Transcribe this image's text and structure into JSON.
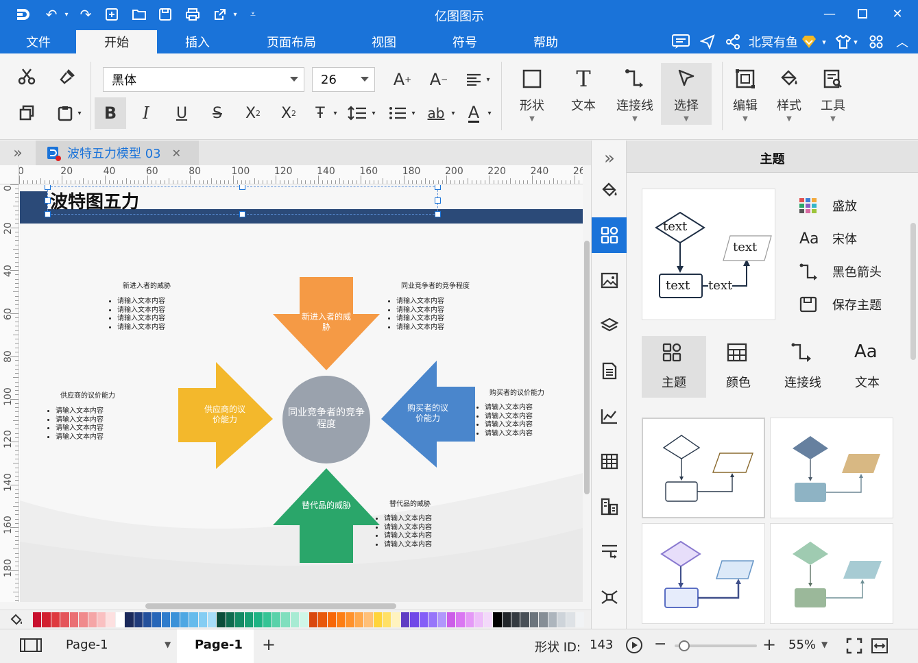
{
  "app": {
    "title": "亿图图示"
  },
  "menu": {
    "items": [
      "文件",
      "开始",
      "插入",
      "页面布局",
      "视图",
      "符号",
      "帮助"
    ],
    "active": "开始",
    "user_name": "北冥有鱼"
  },
  "ribbon": {
    "font_family": "黑体",
    "font_size": "26",
    "tools": [
      {
        "label": "形状",
        "icon": "square-icon"
      },
      {
        "label": "文本",
        "icon": "text-t-icon"
      },
      {
        "label": "连接线",
        "icon": "connector-icon"
      },
      {
        "label": "选择",
        "icon": "pointer-icon"
      },
      {
        "label": "编辑",
        "icon": "edit-icon"
      },
      {
        "label": "样式",
        "icon": "fill-bucket-icon"
      },
      {
        "label": "工具",
        "icon": "tools-icon"
      }
    ]
  },
  "doc": {
    "tab_title": "波特五力模型 03"
  },
  "rulers": {
    "h": [
      "0",
      "20",
      "40",
      "60",
      "80",
      "100",
      "120",
      "140",
      "160",
      "180",
      "200",
      "220",
      "240",
      "26"
    ],
    "v": [
      "0",
      "20",
      "40",
      "60",
      "80",
      "100",
      "120",
      "140",
      "160",
      "180"
    ]
  },
  "diagram": {
    "title": "波特图五力",
    "center": "同业竞争者的竞争程度",
    "top_arrow": "新进入者的威胁",
    "left_arrow": "供应商的议价能力",
    "right_arrow": "购买者的议价能力",
    "bottom_arrow": "替代品的威胁",
    "blocks": {
      "top_left": {
        "title": "新进入者的威胁",
        "items": [
          "请输入文本内容",
          "请输入文本内容",
          "请输入文本内容",
          "请输入文本内容"
        ]
      },
      "top_right": {
        "title": "同业竞争者的竞争程度",
        "items": [
          "请输入文本内容",
          "请输入文本内容",
          "请输入文本内容",
          "请输入文本内容"
        ]
      },
      "left": {
        "title": "供应商的议价能力",
        "items": [
          "请输入文本内容",
          "请输入文本内容",
          "请输入文本内容",
          "请输入文本内容"
        ]
      },
      "right": {
        "title": "购买者的议价能力",
        "items": [
          "请输入文本内容",
          "请输入文本内容",
          "请输入文本内容",
          "请输入文本内容"
        ]
      },
      "bottom": {
        "title": "替代品的威胁",
        "items": [
          "请输入文本内容",
          "请输入文本内容",
          "请输入文本内容",
          "请输入文本内容"
        ]
      }
    },
    "colors": {
      "top": "#f59a45",
      "left": "#f3b82c",
      "right": "#4a86cc",
      "bottom": "#2aa66a",
      "center": "#9aa2ad",
      "header": "#2b4a78"
    }
  },
  "panel": {
    "title": "主题",
    "options": [
      "盛放",
      "宋体",
      "黑色箭头",
      "保存主题"
    ],
    "preview_texts": [
      "text",
      "text",
      "text",
      "text"
    ],
    "tabs": [
      "主题",
      "颜色",
      "连接线",
      "文本"
    ],
    "active_tab": "主题"
  },
  "status": {
    "page_select": "Page-1",
    "page_tab": "Page-1",
    "shape_label": "形状 ID:",
    "shape_id": "143",
    "zoom": "55%",
    "zoom_fraction": 0.08
  }
}
